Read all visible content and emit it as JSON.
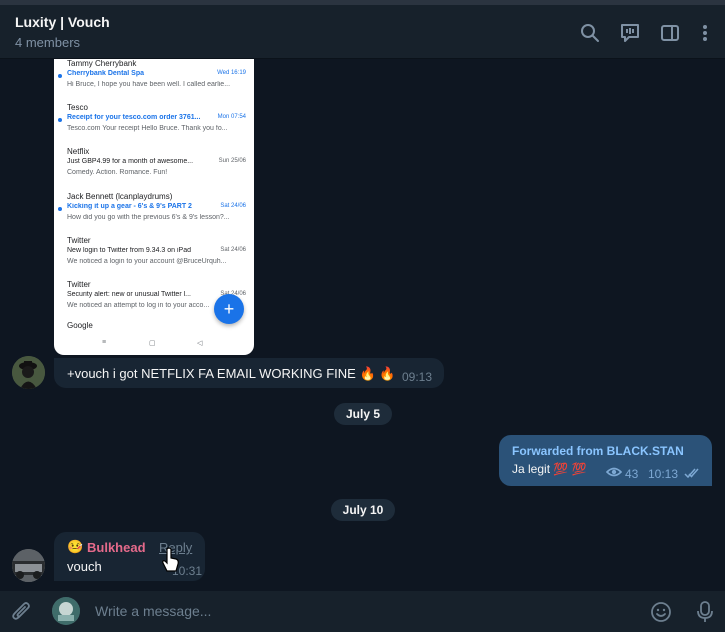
{
  "header": {
    "title": "Luxity | Vouch",
    "subtitle": "4 members"
  },
  "screenshot": {
    "emails": [
      {
        "from": "Tammy Cherrybank",
        "subject": "Cherrybank Dental Spa",
        "date": "Wed 16:19",
        "snippet": "Hi Bruce, I hope you have been well. I called earlie...",
        "unread": true
      },
      {
        "from": "Tesco",
        "subject": "Receipt for your tesco.com order 3761...",
        "date": "Mon 07:54",
        "snippet": "Tesco.com Your receipt Hello Bruce. Thank you fo...",
        "unread": true
      },
      {
        "from": "Netflix",
        "subject": "Just GBP4.99 for a month of awesome...",
        "date": "Sun 25/06",
        "snippet": "Comedy. Action. Romance. Fun!",
        "unread": false
      },
      {
        "from": "Jack Bennett (lcanplaydrums)",
        "subject": "Kicking it up a gear - 6's & 9's PART 2",
        "date": "Sat 24/06",
        "snippet": "How did you go with the previous 6's & 9's lesson?...",
        "unread": true
      },
      {
        "from": "Twitter",
        "subject": "New login to Twitter from 9.34.3 on iPad",
        "date": "Sat 24/06",
        "snippet": "We noticed a login to your account @BruceUrquh...",
        "unread": false
      },
      {
        "from": "Twitter",
        "subject": "Security alert: new or unusual Twitter l...",
        "date": "Sat 24/06",
        "snippet": "We noticed an attempt to log in to your acco...",
        "unread": false
      }
    ],
    "last_from": "Google",
    "fab": "+",
    "nav": [
      "≡",
      "▢",
      "◁"
    ]
  },
  "messages": {
    "m1": {
      "text": "+vouch i got NETFLIX FA EMAIL WORKING FINE 🔥 🔥",
      "time": "09:13"
    },
    "date1": "July 5",
    "fwd": {
      "label": "Forwarded from BLACK.STAN",
      "text": "Ja legit 💯 💯",
      "views": "43",
      "time": "10:13"
    },
    "date2": "July 10",
    "m2": {
      "emoji": "🤒",
      "name": "Bulkhead",
      "reply": "Reply",
      "text": "vouch",
      "time": "10:31"
    }
  },
  "composer": {
    "placeholder": "Write a message..."
  },
  "icons": {
    "search": "search-icon",
    "calls": "video-chat-icon",
    "sidebar": "sidebar-toggle-icon",
    "more": "more-icon",
    "attach": "paperclip-icon",
    "emoji": "emoji-icon",
    "mic": "microphone-icon"
  }
}
